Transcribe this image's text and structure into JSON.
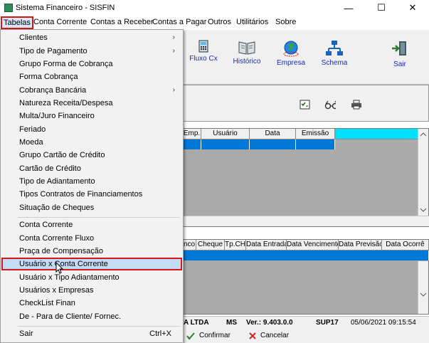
{
  "window": {
    "title": "Sistema Financeiro - SISFIN",
    "minimize": "—",
    "maximize": "☐",
    "close": "✕"
  },
  "menubar": [
    "Tabelas",
    "Conta Corrente",
    "Contas a Receber",
    "Contas a Pagar",
    "Outros",
    "Utilitários",
    "Sobre"
  ],
  "toolbar": {
    "fluxo": "Fluxo Cx",
    "historico": "Histórico",
    "empresa": "Empresa",
    "schema": "Schema",
    "sair": "Sair"
  },
  "grid1": {
    "headers": [
      "Emp.",
      "Usuário",
      "Data",
      "Emissão"
    ]
  },
  "grid2": {
    "headers": [
      "nco",
      "Cheque",
      "Tp.CH",
      "Data Entrada",
      "Data Vencimento",
      "Data Previsão",
      "Data Ocorrê"
    ]
  },
  "status": {
    "company": "A LTDA",
    "state": "MS",
    "version": "Ver.: 9.403.0.0",
    "code": "SUP17",
    "datetime": "05/06/2021 09:15:54"
  },
  "actions": {
    "confirm": "Confirmar",
    "cancel": "Cancelar"
  },
  "dropdown": {
    "items": [
      {
        "label": "Clientes",
        "submenu": true
      },
      {
        "label": "Tipo de Pagamento",
        "submenu": true
      },
      {
        "label": "Grupo Forma de Cobrança"
      },
      {
        "label": "Forma Cobrança"
      },
      {
        "label": "Cobrança Bancária",
        "submenu": true
      },
      {
        "label": "Natureza Receita/Despesa"
      },
      {
        "label": "Multa/Juro Financeiro"
      },
      {
        "label": "Feriado"
      },
      {
        "label": "Moeda"
      },
      {
        "label": "Grupo Cartão de Crédito"
      },
      {
        "label": "Cartão de Crédito"
      },
      {
        "label": "Tipo de Adiantamento"
      },
      {
        "label": "Tipos Contratos de Financiamentos"
      },
      {
        "label": "Situação de Cheques"
      },
      {
        "label": "Conta Corrente"
      },
      {
        "label": "Conta Corrente Fluxo"
      },
      {
        "label": "Praça de Compensação"
      },
      {
        "label": "Usuário x Conta Corrente",
        "highlighted": true
      },
      {
        "label": "Usuário x Tipo Adiantamento"
      },
      {
        "label": "Usuários x Empresas"
      },
      {
        "label": "CheckList Finan"
      },
      {
        "label": "De - Para de Cliente/ Fornec."
      },
      {
        "label": "Sair",
        "shortcut": "Ctrl+X"
      }
    ],
    "arrow": "›"
  },
  "colors": {
    "highlight_border": "#d7151b",
    "selection": "#0078d7",
    "cyan_header": "#00e1ff"
  }
}
